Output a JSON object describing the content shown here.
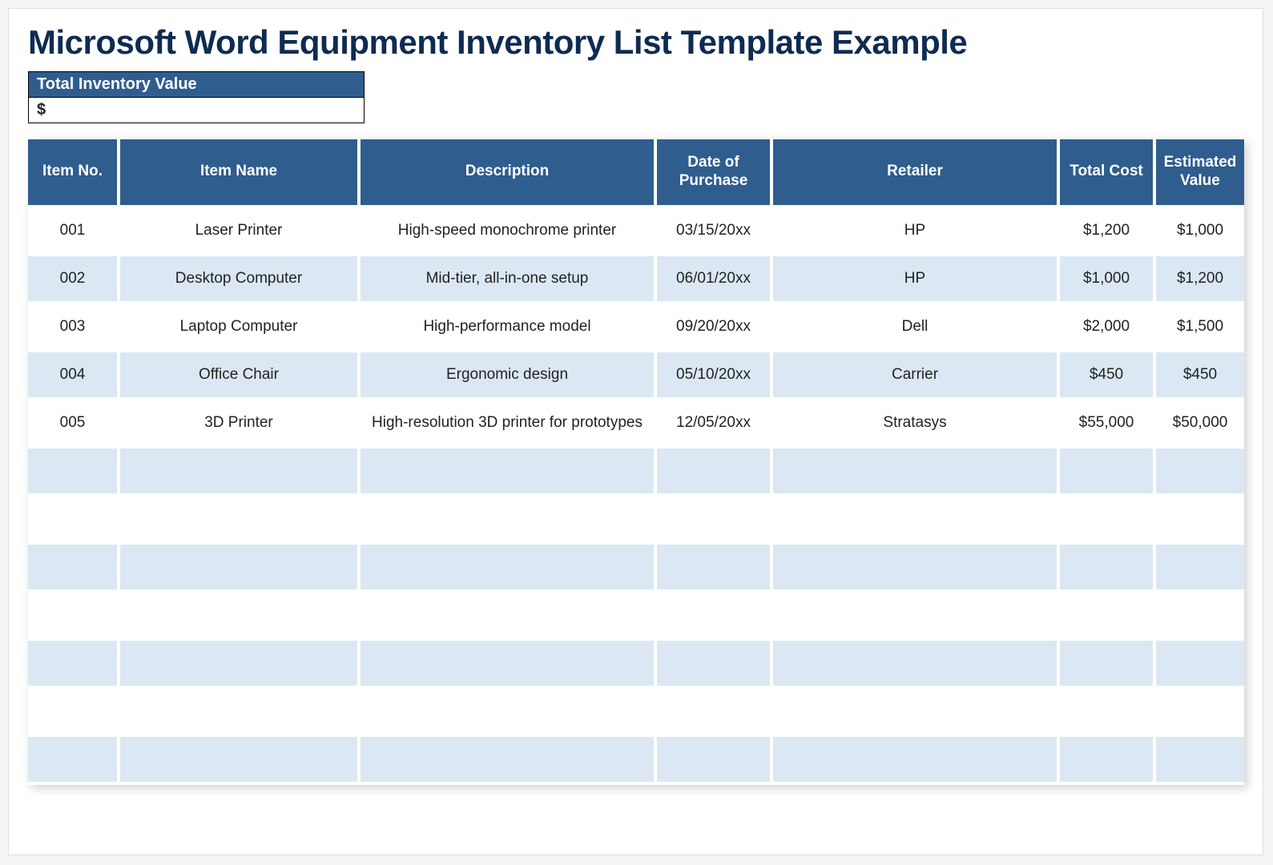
{
  "title": "Microsoft Word Equipment Inventory List Template Example",
  "totalInventory": {
    "label": "Total Inventory Value",
    "value": "$"
  },
  "table": {
    "headers": {
      "itemNo": "Item No.",
      "itemName": "Item Name",
      "description": "Description",
      "date": "Date of Purchase",
      "retailer": "Retailer",
      "totalCost": "Total Cost",
      "estValue": "Estimated Value"
    },
    "rows": [
      {
        "itemNo": "001",
        "itemName": "Laser Printer",
        "description": "High-speed monochrome printer",
        "date": "03/15/20xx",
        "retailer": "HP",
        "totalCost": "$1,200",
        "estValue": "$1,000"
      },
      {
        "itemNo": "002",
        "itemName": "Desktop Computer",
        "description": "Mid-tier, all-in-one setup",
        "date": "06/01/20xx",
        "retailer": "HP",
        "totalCost": "$1,000",
        "estValue": "$1,200"
      },
      {
        "itemNo": "003",
        "itemName": "Laptop Computer",
        "description": "High-performance model",
        "date": "09/20/20xx",
        "retailer": "Dell",
        "totalCost": "$2,000",
        "estValue": "$1,500"
      },
      {
        "itemNo": "004",
        "itemName": "Office Chair",
        "description": "Ergonomic design",
        "date": "05/10/20xx",
        "retailer": "Carrier",
        "totalCost": "$450",
        "estValue": "$450"
      },
      {
        "itemNo": "005",
        "itemName": "3D Printer",
        "description": "High-resolution 3D printer for prototypes",
        "date": "12/05/20xx",
        "retailer": "Stratasys",
        "totalCost": "$55,000",
        "estValue": "$50,000"
      },
      {
        "itemNo": "",
        "itemName": "",
        "description": "",
        "date": "",
        "retailer": "",
        "totalCost": "",
        "estValue": ""
      },
      {
        "itemNo": "",
        "itemName": "",
        "description": "",
        "date": "",
        "retailer": "",
        "totalCost": "",
        "estValue": ""
      },
      {
        "itemNo": "",
        "itemName": "",
        "description": "",
        "date": "",
        "retailer": "",
        "totalCost": "",
        "estValue": ""
      },
      {
        "itemNo": "",
        "itemName": "",
        "description": "",
        "date": "",
        "retailer": "",
        "totalCost": "",
        "estValue": ""
      },
      {
        "itemNo": "",
        "itemName": "",
        "description": "",
        "date": "",
        "retailer": "",
        "totalCost": "",
        "estValue": ""
      },
      {
        "itemNo": "",
        "itemName": "",
        "description": "",
        "date": "",
        "retailer": "",
        "totalCost": "",
        "estValue": ""
      },
      {
        "itemNo": "",
        "itemName": "",
        "description": "",
        "date": "",
        "retailer": "",
        "totalCost": "",
        "estValue": ""
      }
    ]
  }
}
